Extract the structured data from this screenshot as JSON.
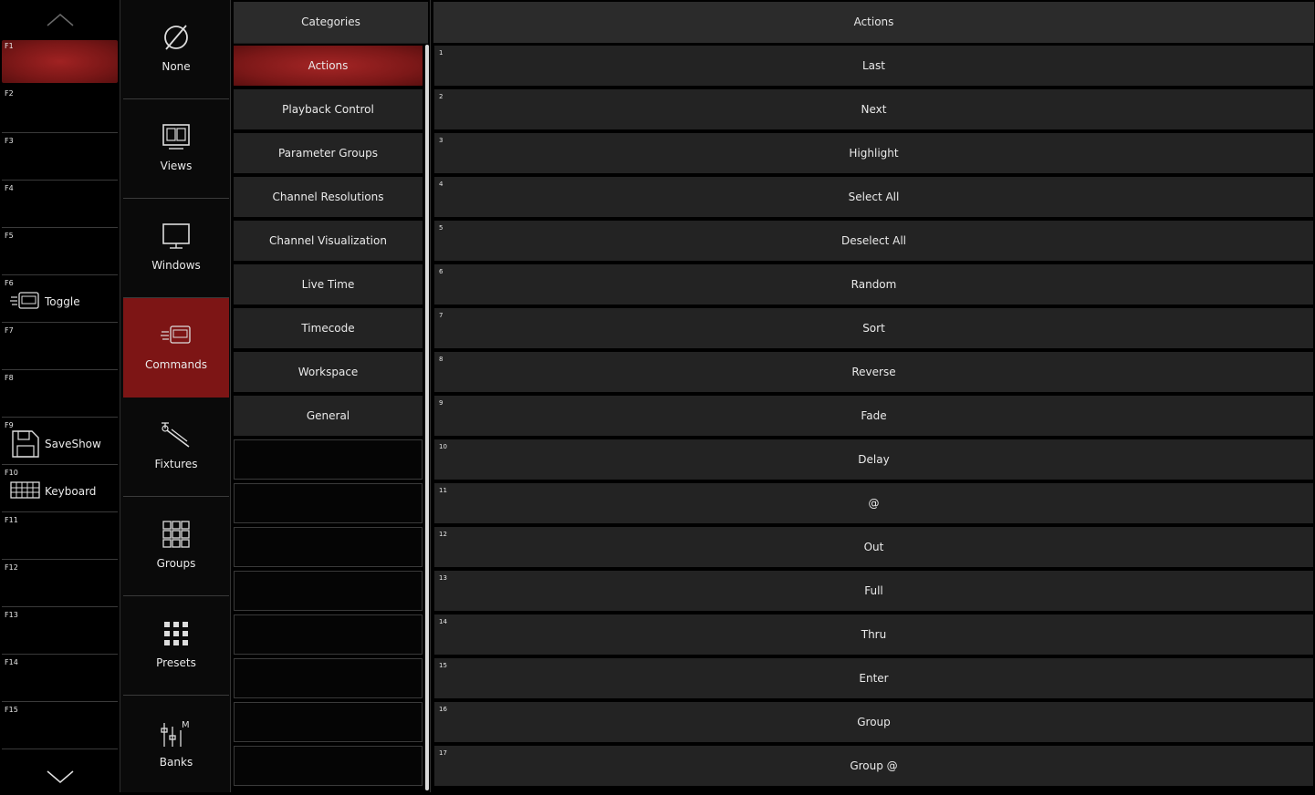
{
  "function_keys": {
    "items": [
      {
        "key": "F1",
        "label": ""
      },
      {
        "key": "F2",
        "label": ""
      },
      {
        "key": "F3",
        "label": ""
      },
      {
        "key": "F4",
        "label": ""
      },
      {
        "key": "F5",
        "label": ""
      },
      {
        "key": "F6",
        "label": "Toggle",
        "icon": "toggle-command-icon"
      },
      {
        "key": "F7",
        "label": ""
      },
      {
        "key": "F8",
        "label": ""
      },
      {
        "key": "F9",
        "label": "SaveShow",
        "icon": "save-icon"
      },
      {
        "key": "F10",
        "label": "Keyboard",
        "icon": "keyboard-icon"
      },
      {
        "key": "F11",
        "label": ""
      },
      {
        "key": "F12",
        "label": ""
      },
      {
        "key": "F13",
        "label": ""
      },
      {
        "key": "F14",
        "label": ""
      },
      {
        "key": "F15",
        "label": ""
      }
    ],
    "active_key": "F1"
  },
  "nav": {
    "items": [
      {
        "label": "None",
        "icon": "none-icon"
      },
      {
        "label": "Views",
        "icon": "views-icon"
      },
      {
        "label": "Windows",
        "icon": "monitor-icon"
      },
      {
        "label": "Commands",
        "icon": "commands-icon"
      },
      {
        "label": "Fixtures",
        "icon": "fixture-icon"
      },
      {
        "label": "Groups",
        "icon": "groups-icon"
      },
      {
        "label": "Presets",
        "icon": "presets-icon"
      },
      {
        "label": "Banks",
        "icon": "banks-icon"
      }
    ],
    "active": "Commands"
  },
  "categories": {
    "header": "Categories",
    "items": [
      "Actions",
      "Playback Control",
      "Parameter Groups",
      "Channel Resolutions",
      "Channel Visualization",
      "Live Time",
      "Timecode",
      "Workspace",
      "General"
    ],
    "active": "Actions"
  },
  "actions": {
    "header": "Actions",
    "items": [
      {
        "num": "1",
        "label": "Last"
      },
      {
        "num": "2",
        "label": "Next"
      },
      {
        "num": "3",
        "label": "Highlight"
      },
      {
        "num": "4",
        "label": "Select All"
      },
      {
        "num": "5",
        "label": "Deselect All"
      },
      {
        "num": "6",
        "label": "Random"
      },
      {
        "num": "7",
        "label": "Sort"
      },
      {
        "num": "8",
        "label": "Reverse"
      },
      {
        "num": "9",
        "label": "Fade"
      },
      {
        "num": "10",
        "label": "Delay"
      },
      {
        "num": "11",
        "label": "@"
      },
      {
        "num": "12",
        "label": "Out"
      },
      {
        "num": "13",
        "label": "Full"
      },
      {
        "num": "14",
        "label": "Thru"
      },
      {
        "num": "15",
        "label": "Enter"
      },
      {
        "num": "16",
        "label": "Group"
      },
      {
        "num": "17",
        "label": "Group @"
      }
    ]
  },
  "colors": {
    "accent_red": "#7d1515",
    "button_bg": "#232323",
    "header_bg": "#2b2b2b"
  }
}
